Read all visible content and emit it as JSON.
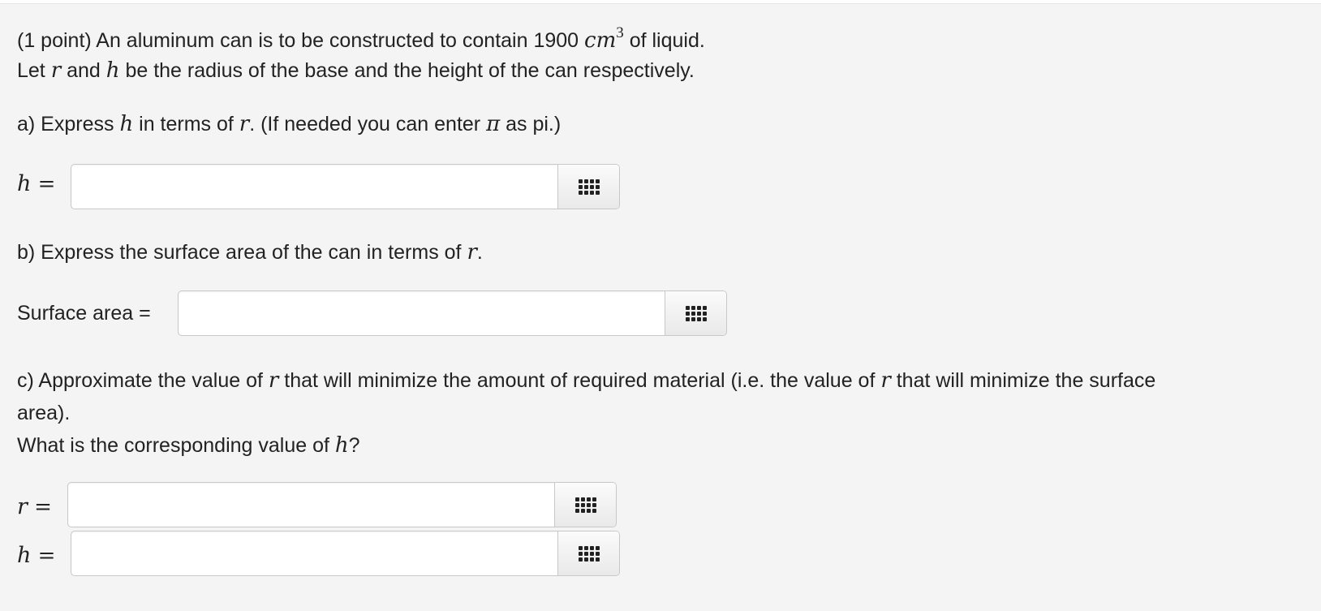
{
  "problem": {
    "intro": {
      "prefix": "(1 point) An aluminum can is to be constructed to contain 1900 ",
      "unit": "cm",
      "unit_exp": "3",
      "suffix": " of liquid."
    },
    "line2": {
      "a": "Let ",
      "r": "r",
      "b": " and ",
      "h": "h",
      "c": " be the radius of the base and the height of the can respectively."
    }
  },
  "part_a": {
    "q_prefix": "a) Express ",
    "q_h": "h",
    "q_mid": " in terms of ",
    "q_r": "r",
    "q_rest": ". (If needed you can enter ",
    "q_pi": "π",
    "q_end": " as pi.)",
    "label_var": "h",
    "label_eq": " =",
    "input_value": "",
    "palette_icon": "grid-icon"
  },
  "part_b": {
    "q_prefix": "b) Express the surface area of the can in terms of ",
    "q_r": "r",
    "q_end": ".",
    "label": "Surface area =",
    "input_value": "",
    "palette_icon": "grid-icon"
  },
  "part_c": {
    "q1_a": "c) Approximate the value of ",
    "q1_r1": "r",
    "q1_b": " that will minimize the amount of required material (i.e. the value of ",
    "q1_r2": "r",
    "q1_c": " that will minimize the surface",
    "q2": "area).",
    "q3_a": "What is the corresponding value of ",
    "q3_h": "h",
    "q3_b": "?",
    "r_label_var": "r",
    "r_label_eq": " =",
    "r_input_value": "",
    "h_label_var": "h",
    "h_label_eq": " =",
    "h_input_value": "",
    "palette_icon": "grid-icon"
  }
}
